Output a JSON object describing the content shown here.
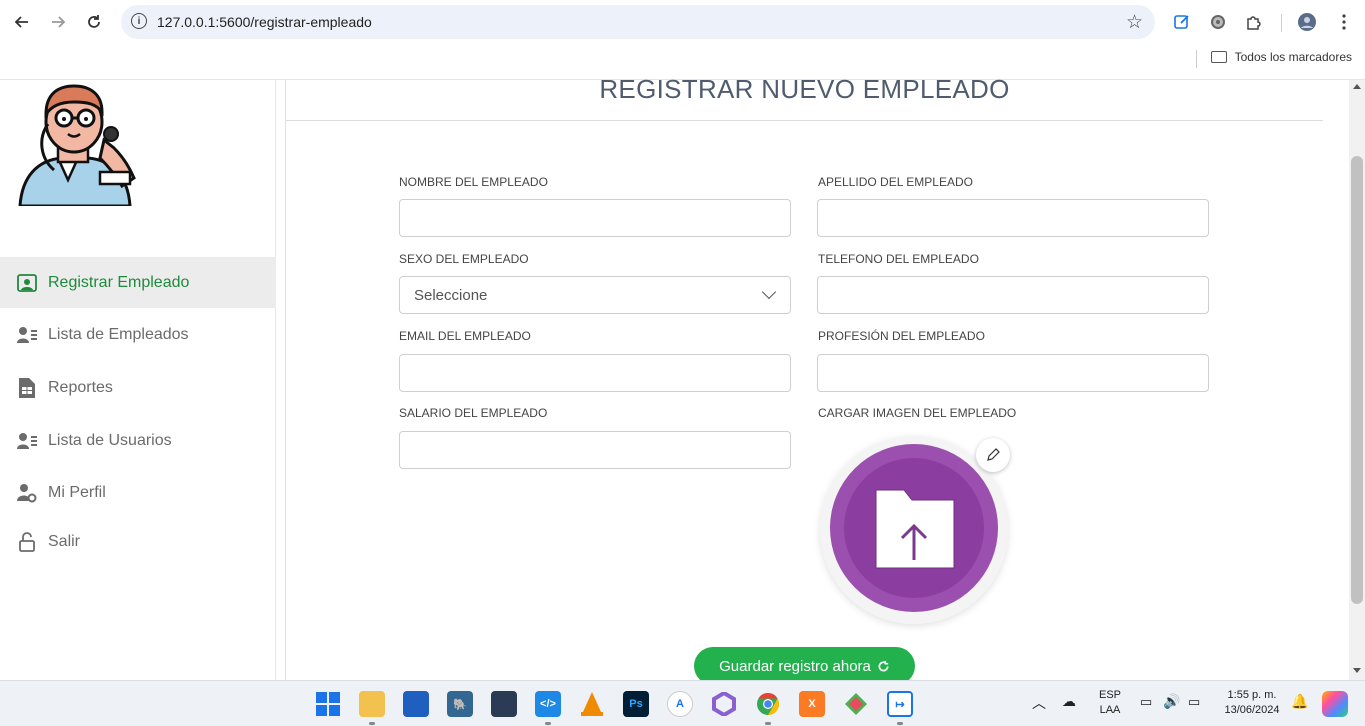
{
  "browser": {
    "url": "127.0.0.1:5600/registrar-empleado",
    "bookmarks_label": "Todos los marcadores"
  },
  "sidebar": {
    "items": [
      {
        "label": "Registrar Empleado",
        "icon": "user-id-icon",
        "active": true
      },
      {
        "label": "Lista de Empleados",
        "icon": "user-list-icon",
        "active": false
      },
      {
        "label": "Reportes",
        "icon": "report-file-icon",
        "active": false
      },
      {
        "label": "Lista de Usuarios",
        "icon": "user-list-icon",
        "active": false
      },
      {
        "label": "Mi Perfil",
        "icon": "user-gear-icon",
        "active": false
      },
      {
        "label": "Salir",
        "icon": "unlock-icon",
        "active": false
      }
    ]
  },
  "main": {
    "title": "REGISTRAR NUEVO EMPLEADO",
    "fields": {
      "nombre_label": "NOMBRE DEL EMPLEADO",
      "apellido_label": "APELLIDO DEL EMPLEADO",
      "sexo_label": "SEXO DEL EMPLEADO",
      "sexo_selected": "Seleccione",
      "telefono_label": "TELEFONO DEL EMPLEADO",
      "email_label": "EMAIL DEL EMPLEADO",
      "profesion_label": "PROFESIÓN DEL EMPLEADO",
      "salario_label": "SALARIO DEL EMPLEADO",
      "imagen_label": "CARGAR IMAGEN DEL EMPLEADO"
    },
    "save_label": "Guardar registro ahora"
  },
  "taskbar": {
    "lang_top": "ESP",
    "lang_bottom": "LAA",
    "time": "1:55 p. m.",
    "date": "13/06/2024"
  },
  "colors": {
    "accent_green": "#22b14c",
    "active_text": "#1e8a3c",
    "upload_purple": "#9b4fae"
  }
}
